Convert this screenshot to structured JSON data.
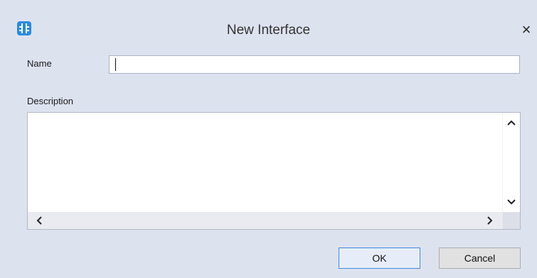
{
  "dialog": {
    "title": "New Interface",
    "close_symbol": "×",
    "app_icon": "interface-app-icon",
    "name_label": "Name",
    "name_value": "",
    "description_label": "Description",
    "description_value": "",
    "scroll": {
      "up": "⌃",
      "down": "⌄",
      "left": "‹",
      "right": "›"
    },
    "ok_label": "OK",
    "cancel_label": "Cancel"
  },
  "colors": {
    "background": "#dde2ef",
    "accent": "#2a8ae0",
    "default_button_border": "#3f8ae0"
  }
}
